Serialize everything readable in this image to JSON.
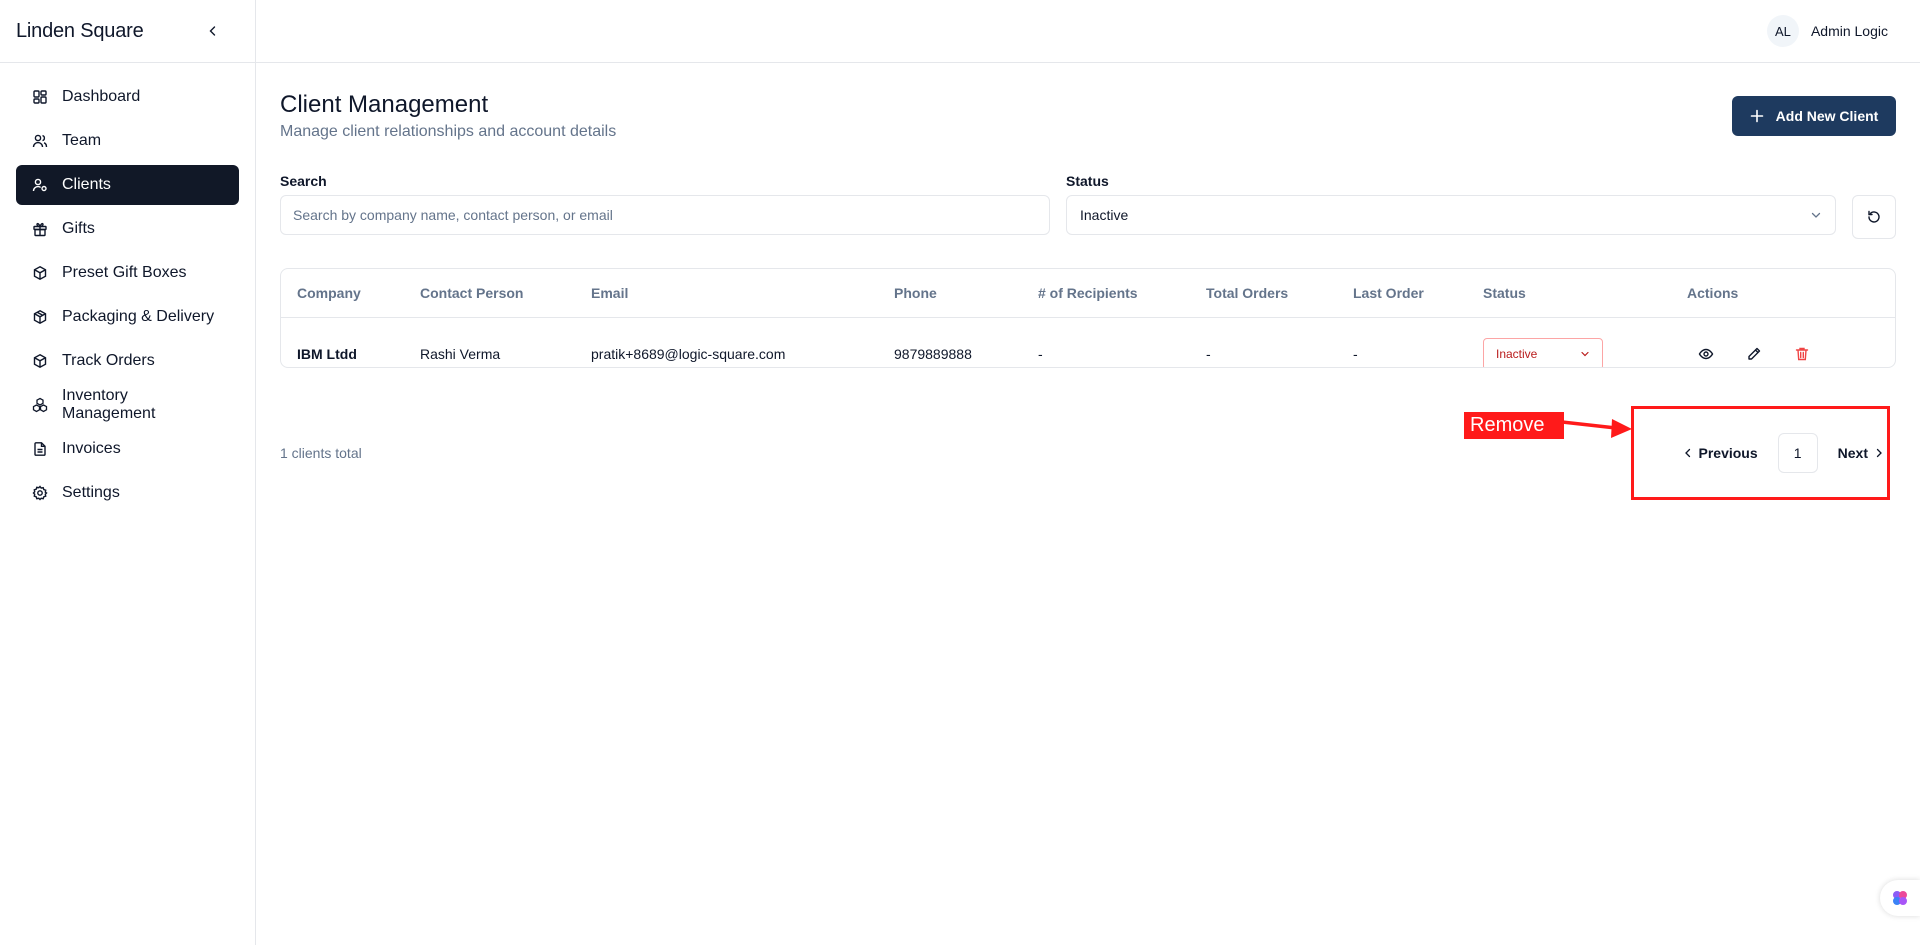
{
  "app": {
    "brand": "Linden Square"
  },
  "user": {
    "initials": "AL",
    "name": "Admin Logic"
  },
  "sidebar": {
    "items": [
      {
        "label": "Dashboard",
        "icon": "dashboard-icon"
      },
      {
        "label": "Team",
        "icon": "users-icon"
      },
      {
        "label": "Clients",
        "icon": "user-cog-icon",
        "active": true
      },
      {
        "label": "Gifts",
        "icon": "gift-icon"
      },
      {
        "label": "Preset Gift Boxes",
        "icon": "box-icon"
      },
      {
        "label": "Packaging & Delivery",
        "icon": "package-icon"
      },
      {
        "label": "Track Orders",
        "icon": "track-icon"
      },
      {
        "label": "Inventory Management",
        "icon": "boxes-icon"
      },
      {
        "label": "Invoices",
        "icon": "file-icon"
      },
      {
        "label": "Settings",
        "icon": "gear-icon"
      }
    ]
  },
  "page": {
    "title": "Client Management",
    "subtitle": "Manage client relationships and account details",
    "add_button": "Add New Client"
  },
  "filters": {
    "search_label": "Search",
    "search_placeholder": "Search by company name, contact person, or email",
    "status_label": "Status",
    "status_value": "Inactive"
  },
  "table": {
    "headers": [
      "Company",
      "Contact Person",
      "Email",
      "Phone",
      "# of Recipients",
      "Total Orders",
      "Last Order",
      "Status",
      "Actions"
    ],
    "rows": [
      {
        "company": "IBM Ltdd",
        "contact": "Rashi Verma",
        "email": "pratik+8689@logic-square.com",
        "phone": "9879889888",
        "recipients": "-",
        "total_orders": "-",
        "last_order": "-",
        "status": "Inactive"
      }
    ]
  },
  "footer": {
    "total": "1 clients total",
    "previous": "Previous",
    "page": "1",
    "next": "Next"
  },
  "annotation": {
    "label": "Remove",
    "color": "#ff1a1a"
  },
  "colors": {
    "primary": "#1e3a5f",
    "active_nav": "#111827",
    "danger": "#ef4444"
  }
}
